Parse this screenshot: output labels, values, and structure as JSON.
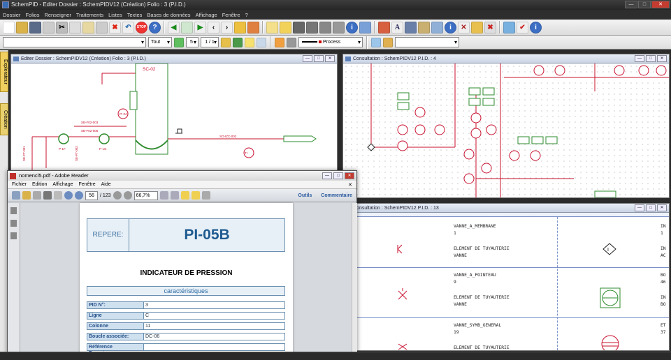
{
  "app": {
    "title": "SchemPID - Editer  Dossier : SchemPIDV12  (Création)  Folio : 3  (P.I.D.)"
  },
  "menubar": [
    "Dossier",
    "Folios",
    "Renseigner",
    "Traitements",
    "Listes",
    "Textes",
    "Bases de données",
    "Affichage",
    "Fenêtre",
    "?"
  ],
  "toolbar2": {
    "combo_empty": "",
    "tout": "Tout",
    "num1": "5",
    "page": "1 / 1",
    "line_style": "Process",
    "combo_last": ""
  },
  "side_tabs": [
    "Explorateur",
    "Création"
  ],
  "window_editer": {
    "title": "Editer  Dossier : SchemPIDV12  (Création)  Folio : 3  (P.I.D.)",
    "tags": [
      "SC-02",
      "PI 04",
      "TI",
      "PI",
      "TI",
      "PI"
    ],
    "lines": [
      "SB-F02-003",
      "SB-F02-006",
      "SE-FT-001",
      "SE-FT-002",
      "SO-IZC-002",
      "SO-IZS-001"
    ],
    "pumps": [
      "P-1F",
      "P-1G"
    ]
  },
  "window_consult4": {
    "title": "Consultation : SchemPIDV12  P.I.D. : 4"
  },
  "window_consult13": {
    "title": "Consultation : SchemPIDV12  P.I.D. : 13",
    "rows": [
      {
        "name": "VANNE_A_MEMBRANE",
        "num": "1",
        "type": "ELEMENT DE TUYAUTERIE",
        "cat": "VANNE",
        "r1": "IN",
        "r2": "1",
        "r3": "IN",
        "r4": "AC"
      },
      {
        "name": "VANNE_A_POINTEAU",
        "num": "9",
        "type": "ELEMENT DE TUYAUTERIE",
        "cat": "VANNE",
        "r1": "BO",
        "r2": "46",
        "r3": "IN",
        "r4": "BO"
      },
      {
        "name": "VANNE_SYMB_GENERAL",
        "num": "19",
        "type": "ELEMENT DE TUYAUTERIE",
        "cat": "",
        "r1": "ET",
        "r2": "37",
        "r3": "",
        "r4": ""
      }
    ]
  },
  "adobe": {
    "title": "nomencl5.pdf - Adobe Reader",
    "menu": [
      "Fichier",
      "Edition",
      "Affichage",
      "Fenêtre",
      "Aide"
    ],
    "page_num": "56",
    "page_total": "/ 123",
    "zoom": "66,7%",
    "outils": "Outils",
    "commentaire": "Commentaire",
    "repere_label": "REPERE:",
    "repere_value": "PI-05B",
    "doc_title": "INDICATEUR DE PRESSION",
    "section": "caractéristiques",
    "fields": [
      {
        "k": "PID N°:",
        "v": "3"
      },
      {
        "k": "Ligne",
        "v": "C"
      },
      {
        "k": "Colonne",
        "v": "11"
      },
      {
        "k": "Boucle associée:",
        "v": "DC-06"
      },
      {
        "k": "Référence Fournisseur:",
        "v": ""
      }
    ]
  },
  "colors": {
    "accent_red": "#c8102e",
    "green": "#2e8b2e",
    "grid_dot": "#9a9a9a"
  }
}
